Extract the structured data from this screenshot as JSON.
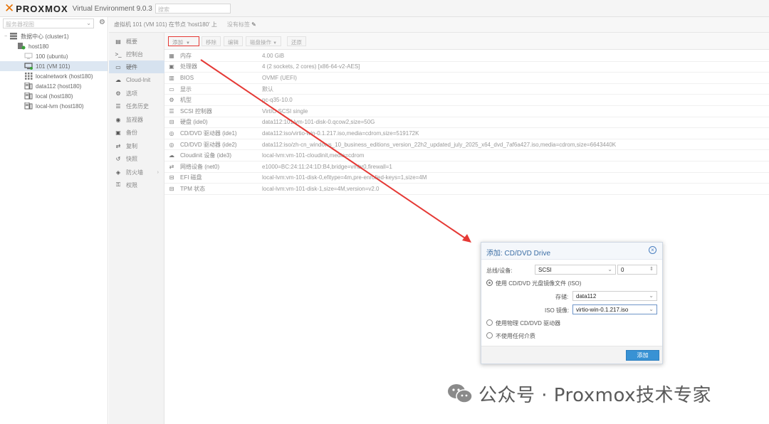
{
  "app": {
    "brand": "PROXMOX",
    "version": "Virtual Environment 9.0.3",
    "search_placeholder": "搜索"
  },
  "tree": {
    "view_selector": "服务器视图",
    "items": [
      {
        "label": "数据中心 (cluster1)",
        "icon": "datacenter-icon"
      },
      {
        "label": "host180",
        "icon": "node-icon"
      },
      {
        "label": "100 (ubuntu)",
        "icon": "vm-icon"
      },
      {
        "label": "101 (VM 101)",
        "icon": "vm-icon"
      },
      {
        "label": "localnetwork (host180)",
        "icon": "network-icon"
      },
      {
        "label": "data112 (host180)",
        "icon": "storage-icon"
      },
      {
        "label": "local (host180)",
        "icon": "storage-icon"
      },
      {
        "label": "local-lvm (host180)",
        "icon": "storage-icon"
      }
    ]
  },
  "content": {
    "title": "虚拟机 101 (VM 101) 在节点 'host180' 上",
    "tags": "没有标签"
  },
  "nav": {
    "items": [
      {
        "label": "概要",
        "icon": "summary-icon"
      },
      {
        "label": "控制台",
        "icon": "console-icon"
      },
      {
        "label": "硬件",
        "icon": "hardware-icon"
      },
      {
        "label": "Cloud-Init",
        "icon": "cloud-icon"
      },
      {
        "label": "选项",
        "icon": "gear-icon"
      },
      {
        "label": "任务历史",
        "icon": "list-icon"
      },
      {
        "label": "监视器",
        "icon": "eye-icon"
      },
      {
        "label": "备份",
        "icon": "floppy-icon"
      },
      {
        "label": "复制",
        "icon": "retweet-icon"
      },
      {
        "label": "快照",
        "icon": "history-icon"
      },
      {
        "label": "防火墙",
        "icon": "shield-icon"
      },
      {
        "label": "权限",
        "icon": "unlock-icon"
      }
    ]
  },
  "toolbar": {
    "add": "添加",
    "remove": "移除",
    "edit": "编辑",
    "disk_action": "磁盘操作",
    "revert": "还原"
  },
  "hardware": [
    {
      "icon": "memory-icon",
      "name": "内存",
      "value": "4.00 GiB"
    },
    {
      "icon": "cpu-icon",
      "name": "处理器",
      "value": "4 (2 sockets, 2 cores) [x86-64-v2-AES]"
    },
    {
      "icon": "microchip-icon",
      "name": "BIOS",
      "value": "OVMF (UEFI)"
    },
    {
      "icon": "desktop-icon",
      "name": "显示",
      "value": "默认"
    },
    {
      "icon": "gears-icon",
      "name": "机型",
      "value": "pc-q35-10.0"
    },
    {
      "icon": "database-icon",
      "name": "SCSI 控制器",
      "value": "VirtIO SCSI single"
    },
    {
      "icon": "hdd-icon",
      "name": "硬盘 (ide0)",
      "value": "data112:101/vm-101-disk-0.qcow2,size=50G"
    },
    {
      "icon": "cdrom-icon",
      "name": "CD/DVD 驱动器 (ide1)",
      "value": "data112:iso/virtio-win-0.1.217.iso,media=cdrom,size=519172K"
    },
    {
      "icon": "cdrom-icon",
      "name": "CD/DVD 驱动器 (ide2)",
      "value": "data112:iso/zh-cn_windows_10_business_editions_version_22h2_updated_july_2025_x64_dvd_7af6a427.iso,media=cdrom,size=6643440K"
    },
    {
      "icon": "cloud-icon",
      "name": "Cloudinit 设备 (ide3)",
      "value": "local-lvm:vm-101-cloudinit,media=cdrom"
    },
    {
      "icon": "exchange-icon",
      "name": "网络设备 (net0)",
      "value": "e1000=BC:24:11:24:1D:B4,bridge=vmbr0,firewall=1"
    },
    {
      "icon": "hdd-icon",
      "name": "EFI 磁盘",
      "value": "local-lvm:vm-101-disk-0,efitype=4m,pre-enrolled-keys=1,size=4M"
    },
    {
      "icon": "hdd-icon",
      "name": "TPM 状态",
      "value": "local-lvm:vm-101-disk-1,size=4M,version=v2.0"
    }
  ],
  "dialog": {
    "title": "添加: CD/DVD Drive",
    "bus_label": "总线/设备:",
    "bus_value": "SCSI",
    "device_value": "0",
    "opt_iso": "使用 CD/DVD 光盘镜像文件 (ISO)",
    "storage_label": "存储:",
    "storage_value": "data112",
    "iso_label": "ISO 镜像:",
    "iso_value": "virtio-win-0.1.217.iso",
    "opt_physical": "使用物理 CD/DVD 驱动器",
    "opt_none": "不使用任何介质",
    "ok": "添加"
  },
  "watermark": {
    "text": "公众号 · Proxmox技术专家"
  },
  "colors": {
    "accent": "#3892d4",
    "annotation": "#e53935",
    "brand_orange": "#e57000"
  }
}
